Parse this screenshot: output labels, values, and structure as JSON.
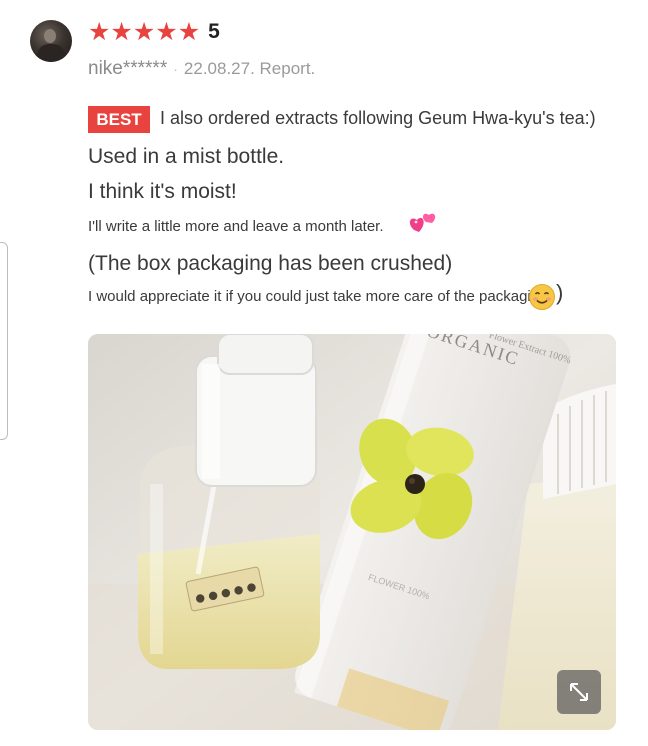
{
  "review": {
    "rating_stars": 5,
    "score": "5",
    "username": "nike******",
    "separator": "·",
    "date": "22.08.27. Report.",
    "badge": "BEST",
    "lines": [
      "I also ordered extracts following Geum Hwa-kyu's tea:)",
      "Used in a mist bottle.",
      "I think it's moist!",
      "I'll write a little more and leave a month later.",
      "(The box packaging has been crushed)",
      "I would appreciate it if you could just take more care of the packaging."
    ],
    "closing_paren": ")"
  },
  "icons": {
    "star": "star-icon",
    "avatar": "user-avatar",
    "hearts": "two-hearts-emoji",
    "smile": "smiling-face-emoji",
    "expand": "expand-arrows-icon"
  },
  "photo": {
    "bottle_label_text": "ORGANIC",
    "bottle_small_text": "Flower Extract 100%"
  },
  "colors": {
    "accent": "#e8433f",
    "muted_text": "#9a9a9a"
  }
}
